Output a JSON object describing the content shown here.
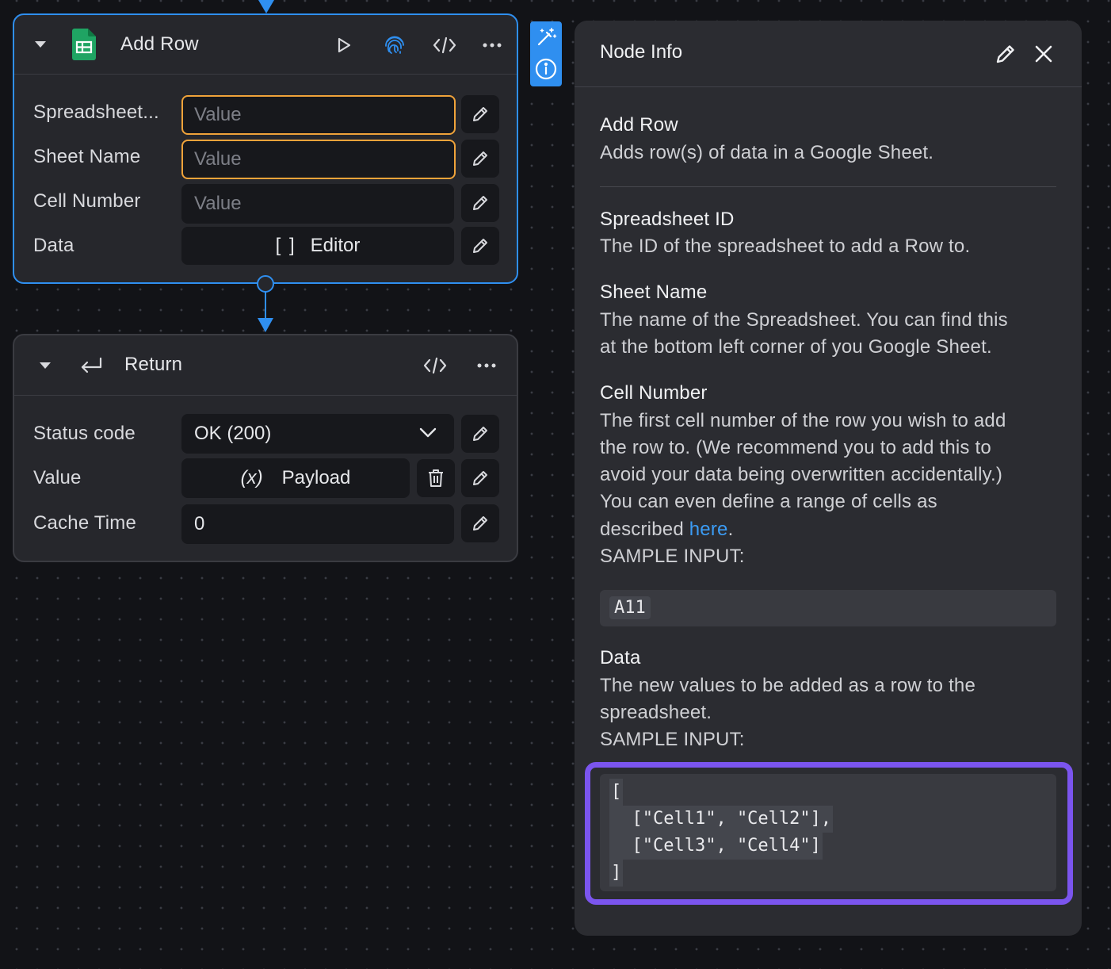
{
  "nodes": {
    "add_row": {
      "title": "Add Row",
      "fields": [
        {
          "label": "Spreadsheet...",
          "value": "",
          "placeholder": "Value"
        },
        {
          "label": "Sheet Name",
          "value": "",
          "placeholder": "Value"
        },
        {
          "label": "Cell Number",
          "value": "",
          "placeholder": "Value"
        },
        {
          "label": "Data",
          "editor_prefix": "[ ]",
          "editor_label": "Editor"
        }
      ]
    },
    "return": {
      "title": "Return",
      "fields": [
        {
          "label": "Status code",
          "value": "OK (200)"
        },
        {
          "label": "Value",
          "var_prefix": "(x)",
          "value": "Payload"
        },
        {
          "label": "Cache Time",
          "value": "0"
        }
      ]
    }
  },
  "panel": {
    "title": "Node Info",
    "node_name": "Add Row",
    "node_description": "Adds row(s) of data in a Google Sheet.",
    "params": [
      {
        "name": "Spreadsheet ID",
        "description": "The ID of the spreadsheet to add a Row to."
      },
      {
        "name": "Sheet Name",
        "description_lines": [
          "The name of the Spreadsheet. You can find this",
          "at the bottom left corner of you Google Sheet."
        ]
      },
      {
        "name": "Cell Number",
        "description_lines": [
          "The first cell number of the row you wish to add",
          "the row to. (We recommend you to add this to",
          "avoid your data being overwritten accidentally.)",
          "You can even define a range of cells as"
        ],
        "described_prefix": "described ",
        "link_text": "here",
        "described_suffix": ".",
        "sample_label": "SAMPLE INPUT:",
        "sample": "A11"
      },
      {
        "name": "Data",
        "description_lines": [
          "The new values to be added as a row to the",
          "spreadsheet."
        ],
        "sample_label": "SAMPLE INPUT:",
        "sample_lines": [
          "[",
          "  [\"Cell1\", \"Cell2\"],",
          "  [\"Cell3\", \"Cell4\"]",
          "]"
        ]
      }
    ]
  },
  "colors": {
    "accent_blue": "#2f8ff0",
    "warning_orange": "#f0a33a",
    "highlight_purple": "#7b55ee",
    "sheets_green": "#1fa463",
    "link_blue": "#3b9cf5"
  },
  "icons": [
    "caret-down-icon",
    "google-sheets-icon",
    "play-icon",
    "fingerprint-icon",
    "code-icon",
    "more-icon",
    "pencil-icon",
    "return-icon",
    "chevron-down-icon",
    "trash-icon",
    "magic-wand-icon",
    "info-icon",
    "close-icon"
  ]
}
